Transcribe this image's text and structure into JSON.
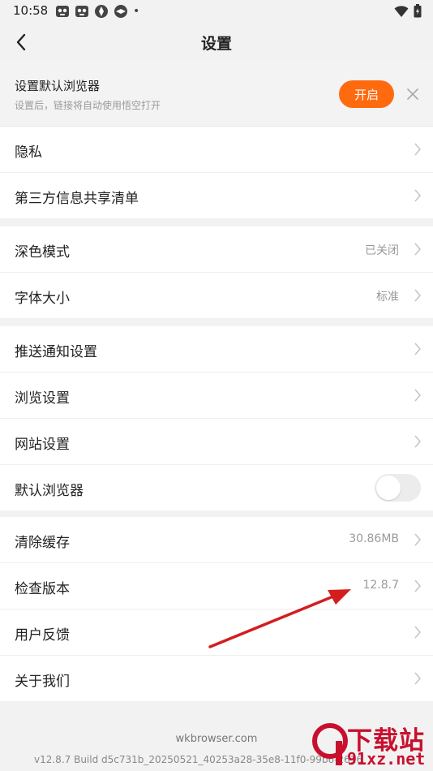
{
  "status": {
    "time": "10:58",
    "notification_icons": [
      "panda-app-icon",
      "panda-app-icon",
      "aperture-app-icon",
      "aperture-app-icon"
    ],
    "dot": "•"
  },
  "header": {
    "title": "设置"
  },
  "banner": {
    "title": "设置默认浏览器",
    "subtitle": "设置后，链接将自动使用悟空打开",
    "button_label": "开启",
    "button_color": "#ff6a0f"
  },
  "groups": [
    {
      "items": [
        {
          "label": "隐私"
        },
        {
          "label": "第三方信息共享清单"
        }
      ]
    },
    {
      "items": [
        {
          "label": "深色模式",
          "value": "已关闭"
        },
        {
          "label": "字体大小",
          "value": "标准"
        }
      ]
    },
    {
      "items": [
        {
          "label": "推送通知设置"
        },
        {
          "label": "浏览设置"
        },
        {
          "label": "网站设置"
        },
        {
          "label": "默认浏览器",
          "toggle": false
        }
      ]
    },
    {
      "items": [
        {
          "label": "清除缓存",
          "value": "30.86MB"
        },
        {
          "label": "检查版本",
          "value": "12.8.7"
        },
        {
          "label": "用户反馈"
        },
        {
          "label": "关于我们"
        }
      ]
    }
  ],
  "footer": {
    "domain": "wkbrowser.com",
    "build": "v12.8.7 Build d5c731b_20250521_40253a28-35e8-11f0-99b6-2616"
  },
  "watermark": {
    "big": "下载站",
    "small": "91xz.net"
  }
}
